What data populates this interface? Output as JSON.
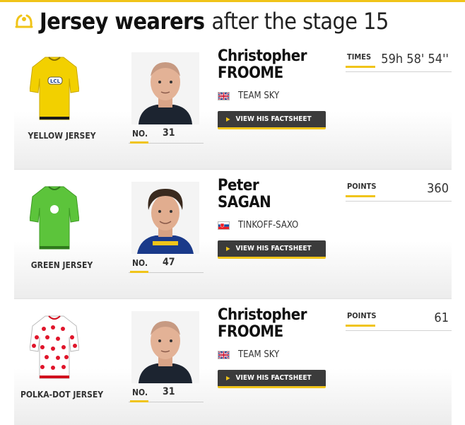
{
  "header": {
    "title_bold": "Jersey wearers",
    "title_light": "after the stage 15",
    "accent_color": "#f0c419"
  },
  "rows": [
    {
      "jersey": {
        "label": "YELLOW JERSEY",
        "color": "#f2d000",
        "icon": "yellow-jersey-icon"
      },
      "number_label": "NO.",
      "number": "31",
      "first_name": "Christopher",
      "last_name": "FROOME",
      "team": "TEAM SKY",
      "flag": "gb-flag-icon",
      "button_label": "VIEW HIS FACTSHEET",
      "stat_label": "TIMES",
      "stat_value": "59h 58' 54''"
    },
    {
      "jersey": {
        "label": "GREEN JERSEY",
        "color": "#5cc43b",
        "icon": "green-jersey-icon"
      },
      "number_label": "NO.",
      "number": "47",
      "first_name": "Peter",
      "last_name": "SAGAN",
      "team": "TINKOFF-SAXO",
      "flag": "sk-flag-icon",
      "button_label": "VIEW HIS FACTSHEET",
      "stat_label": "POINTS",
      "stat_value": "360"
    },
    {
      "jersey": {
        "label": "POLKA-DOT JERSEY",
        "color": "#ffffff",
        "icon": "polka-dot-jersey-icon"
      },
      "number_label": "NO.",
      "number": "31",
      "first_name": "Christopher",
      "last_name": "FROOME",
      "team": "TEAM SKY",
      "flag": "gb-flag-icon",
      "button_label": "VIEW HIS FACTSHEET",
      "stat_label": "POINTS",
      "stat_value": "61"
    }
  ]
}
